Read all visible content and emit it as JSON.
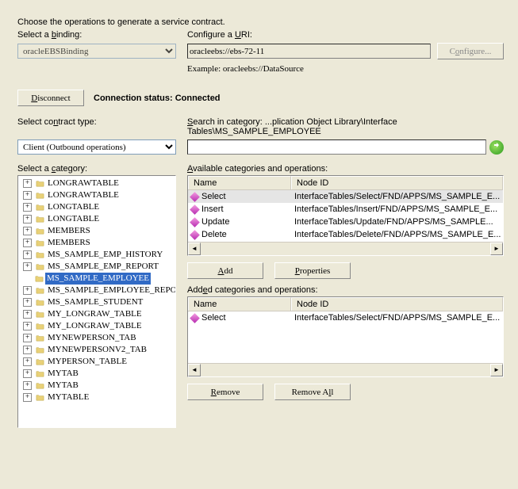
{
  "intro": "Choose the operations to generate a service contract.",
  "binding": {
    "label_pre": "Select a ",
    "label_u": "b",
    "label_post": "inding:",
    "value": "oracleEBSBinding"
  },
  "uri": {
    "label_pre": "Configure a ",
    "label_u": "U",
    "label_post": "RI:",
    "value": "oracleebs://ebs-72-11",
    "example_lbl": "Example:",
    "example_val": "oracleebs://DataSource"
  },
  "cfg_btn_pre": "C",
  "cfg_btn_u": "o",
  "cfg_btn_post": "nfigure...",
  "disconnect_pre": "",
  "disconnect_u": "D",
  "disconnect_post": "isconnect",
  "conn_status_lbl": "Connection status:",
  "conn_status_val": "Connected",
  "contract": {
    "label_pre": "Select co",
    "label_u": "n",
    "label_post": "tract type:",
    "value": "Client (Outbound operations)"
  },
  "search": {
    "label_pre": "",
    "label_u": "S",
    "label_post": "earch in category:",
    "path": "...plication Object Library\\Interface Tables\\MS_SAMPLE_EMPLOYEE"
  },
  "category_lbl_pre": "Select a ",
  "category_lbl_u": "c",
  "category_lbl_post": "ategory:",
  "tree": [
    {
      "name": "LONGRAWTABLE"
    },
    {
      "name": "LONGRAWTABLE"
    },
    {
      "name": "LONGTABLE"
    },
    {
      "name": "LONGTABLE"
    },
    {
      "name": "MEMBERS"
    },
    {
      "name": "MEMBERS"
    },
    {
      "name": "MS_SAMPLE_EMP_HISTORY"
    },
    {
      "name": "MS_SAMPLE_EMP_REPORT"
    },
    {
      "name": "MS_SAMPLE_EMPLOYEE",
      "selected": true,
      "leaf": true
    },
    {
      "name": "MS_SAMPLE_EMPLOYEE_REPORT"
    },
    {
      "name": "MS_SAMPLE_STUDENT"
    },
    {
      "name": "MY_LONGRAW_TABLE"
    },
    {
      "name": "MY_LONGRAW_TABLE"
    },
    {
      "name": "MYNEWPERSON_TAB"
    },
    {
      "name": "MYNEWPERSONV2_TAB"
    },
    {
      "name": "MYPERSON_TABLE"
    },
    {
      "name": "MYTAB"
    },
    {
      "name": "MYTAB"
    },
    {
      "name": "MYTABLE"
    }
  ],
  "avail_lbl_pre": "",
  "avail_lbl_u": "A",
  "avail_lbl_post": "vailable categories and operations:",
  "col_name": "Name",
  "col_node": "Node ID",
  "available": [
    {
      "name": "Select",
      "node": "InterfaceTables/Select/FND/APPS/MS_SAMPLE_E...",
      "selected": true
    },
    {
      "name": "Insert",
      "node": "InterfaceTables/Insert/FND/APPS/MS_SAMPLE_E..."
    },
    {
      "name": "Update",
      "node": "InterfaceTables/Update/FND/APPS/MS_SAMPLE..."
    },
    {
      "name": "Delete",
      "node": "InterfaceTables/Delete/FND/APPS/MS_SAMPLE_E..."
    }
  ],
  "btn_add_u": "A",
  "btn_add_post": "dd",
  "btn_props_u": "P",
  "btn_props_post": "roperties",
  "added_lbl_pre": "Add",
  "added_lbl_u": "e",
  "added_lbl_post": "d categories and operations:",
  "added": [
    {
      "name": "Select",
      "node": "InterfaceTables/Select/FND/APPS/MS_SAMPLE_E..."
    }
  ],
  "btn_remove_u": "R",
  "btn_remove_post": "emove",
  "btn_remove_all_pre": "Remove A",
  "btn_remove_all_u": "l",
  "btn_remove_all_post": "l"
}
